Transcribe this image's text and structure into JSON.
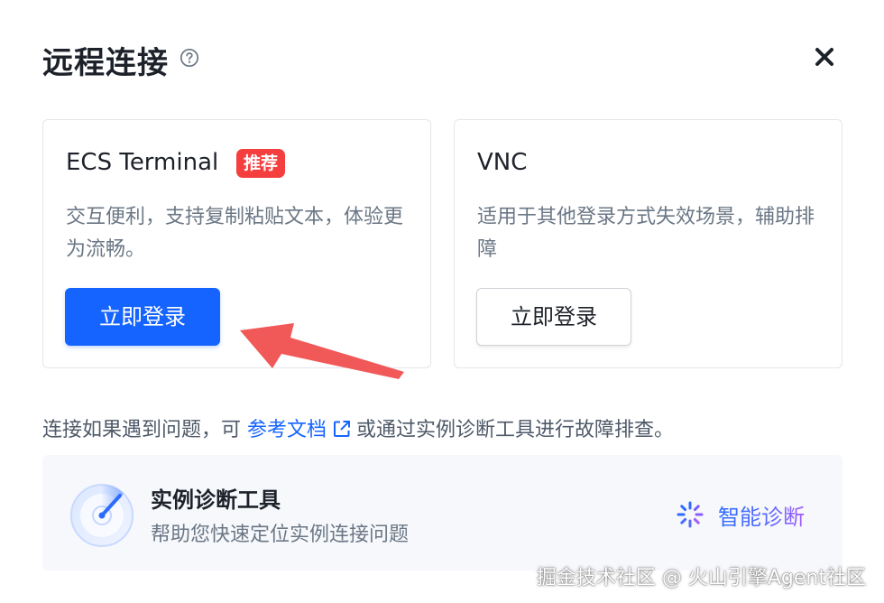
{
  "dialog": {
    "title": "远程连接",
    "help_icon": "question-circle-icon",
    "close_icon": "close-icon"
  },
  "cards": {
    "ecs": {
      "title": "ECS Terminal",
      "badge": "推荐",
      "description": "交互便利，支持复制粘贴文本，体验更为流畅。",
      "button_label": "立即登录"
    },
    "vnc": {
      "title": "VNC",
      "description": "适用于其他登录方式失效场景，辅助排障",
      "button_label": "立即登录"
    }
  },
  "info": {
    "prefix": "连接如果遇到问题，可 ",
    "link_text": "参考文档",
    "link_icon": "external-link-icon",
    "suffix": "或通过实例诊断工具进行故障排查。"
  },
  "diagnosis_tool": {
    "title": "实例诊断工具",
    "description": "帮助您快速定位实例连接问题",
    "action_label": "智能诊断",
    "action_icon": "sparkle-icon"
  },
  "watermark": "掘金技术社区 @ 火山引擎Agent社区",
  "colors": {
    "primary": "#1664ff",
    "badge": "#f53f3f",
    "annotation_arrow": "#f04f4f",
    "panel_bg": "#f6f8fc"
  }
}
